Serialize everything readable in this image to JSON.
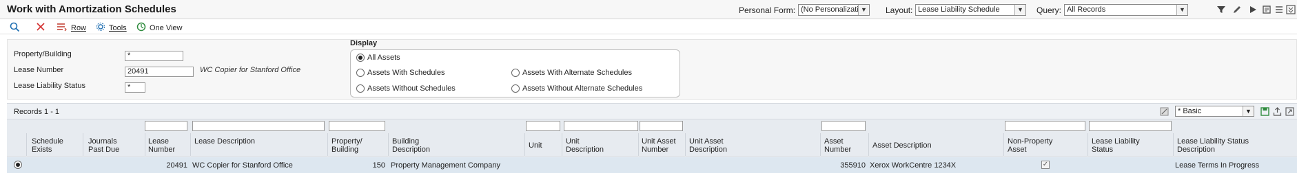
{
  "app": {
    "title": "Work with Amortization Schedules"
  },
  "titlebar": {
    "personal_form_label": "Personal Form:",
    "personal_form_value": "(No Personalization)",
    "layout_label": "Layout:",
    "layout_value": "Lease Liability Schedule",
    "query_label": "Query:",
    "query_value": "All Records",
    "icons": [
      "filter-icon",
      "edit-icon",
      "play-icon",
      "settings-icon",
      "list-icon",
      "list-icon",
      "help-icon"
    ]
  },
  "toolbar": {
    "row_label": "Row",
    "tools_label": "Tools",
    "oneview_label": "One View"
  },
  "criteria": {
    "property_label": "Property/Building",
    "property_value": "*",
    "lease_number_label": "Lease Number",
    "lease_number_value": "20491",
    "lease_description": "WC Copier for Stanford Office",
    "status_label": "Lease Liability Status",
    "status_value": "*"
  },
  "display": {
    "title": "Display",
    "options": [
      "All Assets",
      "Assets With Schedules",
      "Assets With Alternate Schedules",
      "Assets Without Schedules",
      "Assets Without Alternate Schedules"
    ],
    "selected": "All Assets"
  },
  "grid": {
    "records": "Records 1 - 1",
    "format": "* Basic",
    "columns": [
      "Schedule Exists",
      "Journals Past Due",
      "Lease Number",
      "Lease Description",
      "Property/ Building",
      "Building Description",
      "Unit",
      "Unit Description",
      "Unit Asset Number",
      "Unit Asset Description",
      "Asset Number",
      "Asset Description",
      "Non-Property Asset",
      "Lease Liability Status",
      "Lease Liability Status Description"
    ],
    "rows": [
      {
        "lease_number": "20491",
        "lease_description": "WC Copier for Stanford Office",
        "property": "150",
        "building_description": "Property Management Company",
        "asset_number": "355910",
        "asset_description": "Xerox WorkCentre 1234X",
        "non_property_asset": "✓",
        "status_description": "Lease Terms In Progress"
      }
    ]
  }
}
